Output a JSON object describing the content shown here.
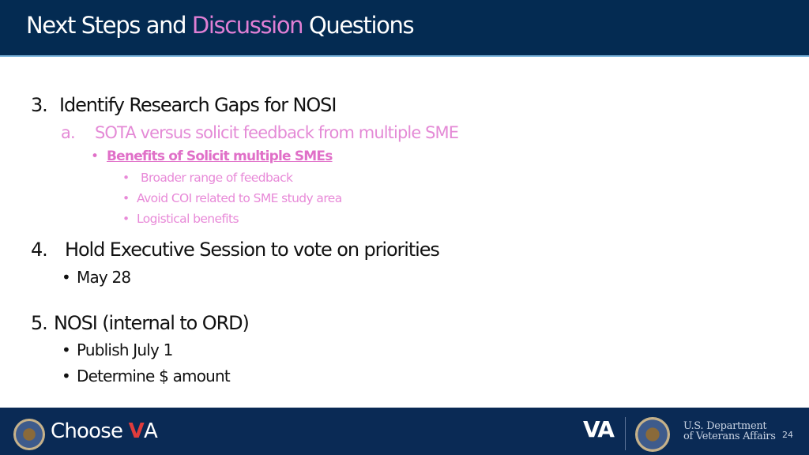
{
  "slide": {
    "title": {
      "part1": "Next Steps and ",
      "accent": "Discussion",
      "part2": " Questions"
    },
    "colors": {
      "header_bg": "#042b52",
      "title_accent": "#e07fd4",
      "footer_bg": "#0a2a55",
      "body_text": "#111111",
      "pink_text": "#e48ad6"
    },
    "items": [
      {
        "number": "3.",
        "text": "Identify Research Gaps for NOSI",
        "sub": {
          "marker": "a.",
          "text": "SOTA versus solicit feedback from multiple SME",
          "heading": "Benefits of Solicit multiple SMEs",
          "bullets": [
            "Broader range of feedback",
            "Avoid COI related to SME study area",
            "Logistical benefits"
          ]
        }
      },
      {
        "number": "4.",
        "text": "Hold Executive Session to vote on priorities",
        "bullets": [
          "May 28"
        ]
      },
      {
        "number": "5.",
        "text": "NOSI (internal to ORD)",
        "bullets": [
          "Publish July 1",
          "Determine $ amount"
        ]
      }
    ],
    "bullet_char": "•"
  },
  "footer": {
    "choose_text": "Choose",
    "choose_check": "V",
    "choose_suffix": "A",
    "va_mark": "VA",
    "dept_line1": "U.S. Department",
    "dept_line2": "of Veterans Affairs",
    "page_number": "24",
    "seal_icon": "va-seal-icon"
  }
}
